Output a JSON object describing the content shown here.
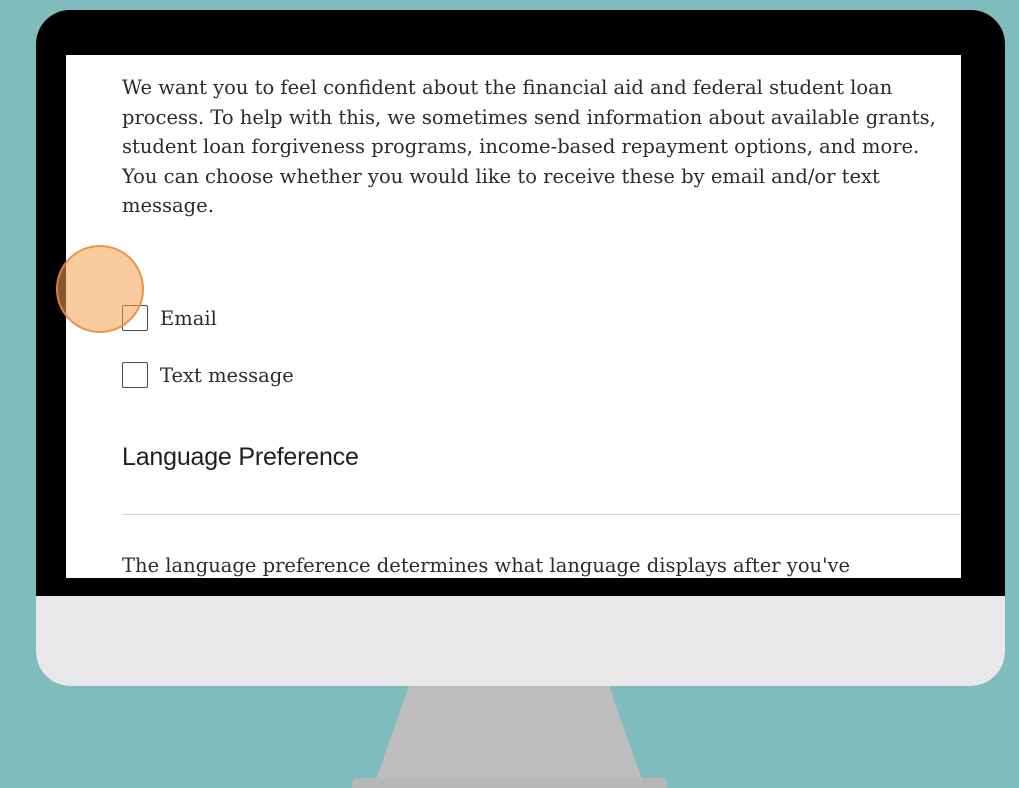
{
  "intro_text": "We want you to feel confident about the financial aid and federal student loan process. To help with this, we sometimes send information about available grants, student loan forgiveness programs, income-based repayment options, and more. You can choose whether you would like to receive these by email and/or text message.",
  "options": [
    {
      "label": "Email",
      "checked": false
    },
    {
      "label": "Text message",
      "checked": false
    }
  ],
  "language_section": {
    "heading": "Language Preference",
    "text": "The language preference determines what language displays after you've"
  },
  "colors": {
    "background": "#7fbcbd",
    "highlight": "#f6a050"
  }
}
